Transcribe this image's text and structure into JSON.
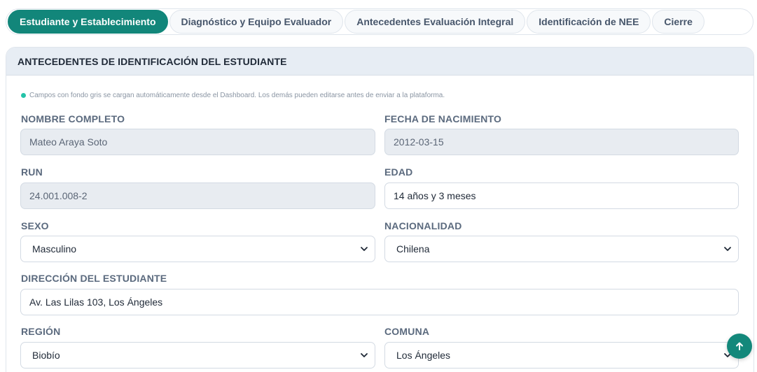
{
  "tabs": [
    {
      "label": "Estudiante y Establecimiento",
      "active": true
    },
    {
      "label": "Diagnóstico y Equipo Evaluador",
      "active": false
    },
    {
      "label": "Antecedentes Evaluación Integral",
      "active": false
    },
    {
      "label": "Identificación de NEE",
      "active": false
    },
    {
      "label": "Cierre",
      "active": false
    }
  ],
  "section": {
    "title": "ANTECEDENTES DE IDENTIFICACIÓN DEL ESTUDIANTE",
    "note": "Campos con fondo gris se cargan automáticamente desde el Dashboard. Los demás pueden editarse antes de enviar a la plataforma."
  },
  "fields": {
    "nombre": {
      "label": "NOMBRE COMPLETO",
      "value": "Mateo Araya Soto"
    },
    "nacimiento": {
      "label": "FECHA DE NACIMIENTO",
      "value": "2012-03-15"
    },
    "run": {
      "label": "RUN",
      "value": "24.001.008-2"
    },
    "edad": {
      "label": "EDAD",
      "value": "14 años y 3 meses"
    },
    "sexo": {
      "label": "SEXO",
      "value": "Masculino"
    },
    "nacionalidad": {
      "label": "NACIONALIDAD",
      "value": "Chilena"
    },
    "direccion": {
      "label": "DIRECCIÓN DEL ESTUDIANTE",
      "value": "Av. Las Lilas 103, Los Ángeles"
    },
    "region": {
      "label": "REGIÓN",
      "value": "Biobío"
    },
    "comuna": {
      "label": "COMUNA",
      "value": "Los Ángeles"
    }
  },
  "icons": {
    "note_dot": "status-dot",
    "select": "chevron-down-icon",
    "fab": "arrow-up-icon"
  },
  "colors": {
    "accent": "#12867a",
    "note_dot": "#24c3a8",
    "readonly_bg": "#e8ecf1",
    "header_bg": "#e7edf4"
  }
}
